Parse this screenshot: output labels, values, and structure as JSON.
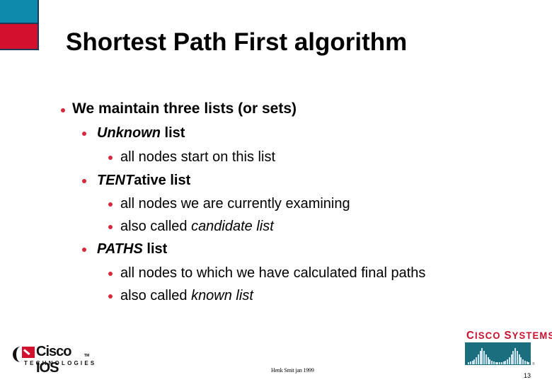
{
  "slide": {
    "title": "Shortest Path First algorithm",
    "bullets": {
      "level1": "We maintain three lists (or sets)",
      "unknown": {
        "italic": "Unknown",
        "rest": " list"
      },
      "unknown_sub1": "all nodes start on this list",
      "tentative": {
        "italic": "TENT",
        "rest": "ative list"
      },
      "tentative_sub1": "all nodes we are currently examining",
      "tentative_sub2": {
        "plain": "also called ",
        "italic": "candidate list"
      },
      "paths": {
        "italic": "PATHS",
        "rest": " list"
      },
      "paths_sub1": "all nodes to which we have calculated final paths",
      "paths_sub2": {
        "plain": "also called ",
        "italic": "known list"
      }
    }
  },
  "footer": {
    "author": "Henk Smit jan 1999",
    "page_number": "13"
  },
  "logos": {
    "ios": {
      "name": "Cisco IOS",
      "tm": "TM",
      "tagline": "TECHNOLOGIES"
    },
    "cisco_systems": {
      "name_parts": [
        "C",
        "ISCO ",
        "S",
        "YSTEMS"
      ],
      "registered": "®"
    }
  },
  "colors": {
    "accent_teal": "#0e8aac",
    "accent_red": "#d3102e",
    "bullet_red": "#d8283c",
    "logo_teal": "#1b6e7d"
  }
}
